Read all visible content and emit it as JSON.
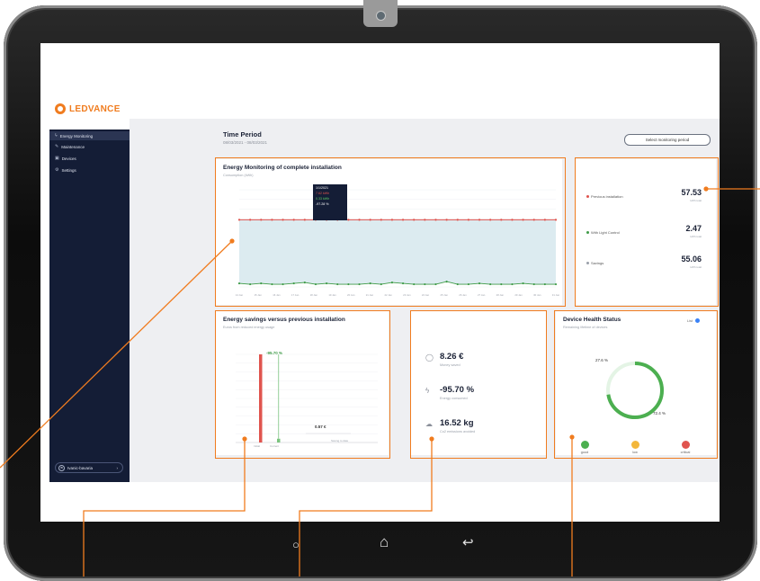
{
  "brand": {
    "name": "LEDVANCE",
    "color": "#f07c1f"
  },
  "sidebar": {
    "items": [
      {
        "label": "Energy Monitoring",
        "icon": "lightning-icon",
        "active": true
      },
      {
        "label": "Maintenance",
        "icon": "wrench-icon",
        "active": false
      },
      {
        "label": "Devices",
        "icon": "devices-icon",
        "active": false
      },
      {
        "label": "Settings",
        "icon": "gear-icon",
        "active": false
      }
    ],
    "user": {
      "initials": "IB",
      "name": "Ivanic-bavaria",
      "chevron": "›"
    }
  },
  "header": {
    "title": "Time Period",
    "range": "08/03/2021 - 08/03/2021",
    "select_period_label": "Select monitoring period"
  },
  "energy_monitoring": {
    "title": "Energy Monitoring of complete installation",
    "subtitle": "Consumption (kWh)",
    "tooltip": {
      "date": "1/1/2021",
      "previous": "7.62 kWh",
      "current": "0.33 kWh",
      "change": "-97.28 %"
    }
  },
  "summary": {
    "rows": [
      {
        "label": "Previous installation",
        "value": "57.53",
        "unit": "kWh total",
        "color": "#e0544e"
      },
      {
        "label": "With Light Control",
        "value": "2.47",
        "unit": "kWh total",
        "color": "#3f9b48"
      },
      {
        "label": "Savings",
        "value": "55.06",
        "unit": "kWh total",
        "color": "#9aa0aa"
      }
    ]
  },
  "savings_chart": {
    "title": "Energy savings versus previous installation",
    "subtitle": "Euros from reduced energy usage",
    "bar_label": "-95.70 %",
    "annotation_value": "0.57 €",
    "annotation_caption": "Saving to date",
    "x_labels": [
      "Initial",
      "Current"
    ],
    "chart_data": {
      "type": "bar",
      "categories": [
        "Initial",
        "Current"
      ],
      "values": [
        100,
        4.3
      ],
      "colors": [
        "#e0544e",
        "#7bc47f"
      ]
    }
  },
  "stats": [
    {
      "icon": "coin-icon",
      "glyph": "◯",
      "value": "8.26 €",
      "desc": "Money saved"
    },
    {
      "icon": "energy-icon",
      "glyph": "ϟ",
      "value": "-95.70 %",
      "desc": "Energy consumed"
    },
    {
      "icon": "cloud-icon",
      "glyph": "☁",
      "value": "16.52 kg",
      "desc": "Co2 emissions avoided"
    }
  ],
  "device_health": {
    "title": "Device Health Status",
    "subtitle": "Remaining lifetime of devices",
    "toggle_label": "List",
    "ring": {
      "percent_a": "27.6 %",
      "percent_b": "72.4 %",
      "fraction_green": 0.724
    },
    "statuses": [
      {
        "label": "good",
        "color": "#4caf50"
      },
      {
        "label": "low",
        "color": "#f3b73b"
      },
      {
        "label": "critical",
        "color": "#e0544e"
      }
    ]
  },
  "line_chart": {
    "x_labels": [
      "14 Jan",
      "15 Jan",
      "16 Jan",
      "17 Jan",
      "18 Jan",
      "19 Jan",
      "20 Jan",
      "21 Jan",
      "22 Jan",
      "23 Jan",
      "24 Jan",
      "25 Jan",
      "26 Jan",
      "27 Jan",
      "28 Jan",
      "29 Jan",
      "30 Jan",
      "31 Jan"
    ],
    "chart_data": {
      "type": "line",
      "series": [
        {
          "values": [
            7.6,
            7.6,
            7.6,
            7.6,
            7.6,
            7.6,
            7.6,
            7.6,
            7.6,
            7.6,
            7.6,
            7.6,
            7.6,
            7.6,
            7.6,
            7.6,
            7.6,
            7.6,
            7.6,
            7.6,
            7.6,
            7.6,
            7.6,
            7.6,
            7.6,
            7.6,
            7.6,
            7.6,
            7.6,
            7.6
          ],
          "color": "#e0544e"
        },
        {
          "values": [
            0.4,
            0.3,
            0.4,
            0.3,
            0.3,
            0.4,
            0.5,
            0.3,
            0.4,
            0.3,
            0.3,
            0.3,
            0.4,
            0.3,
            0.5,
            0.4,
            0.3,
            0.3,
            0.3,
            0.6,
            0.3,
            0.3,
            0.4,
            0.3,
            0.3,
            0.3,
            0.4,
            0.3,
            0.3,
            0.3
          ],
          "color": "#3f9b48"
        }
      ],
      "ylim": [
        0,
        11
      ]
    }
  },
  "android_nav": {
    "back": "↩",
    "home": "⌂",
    "recent": "○"
  }
}
